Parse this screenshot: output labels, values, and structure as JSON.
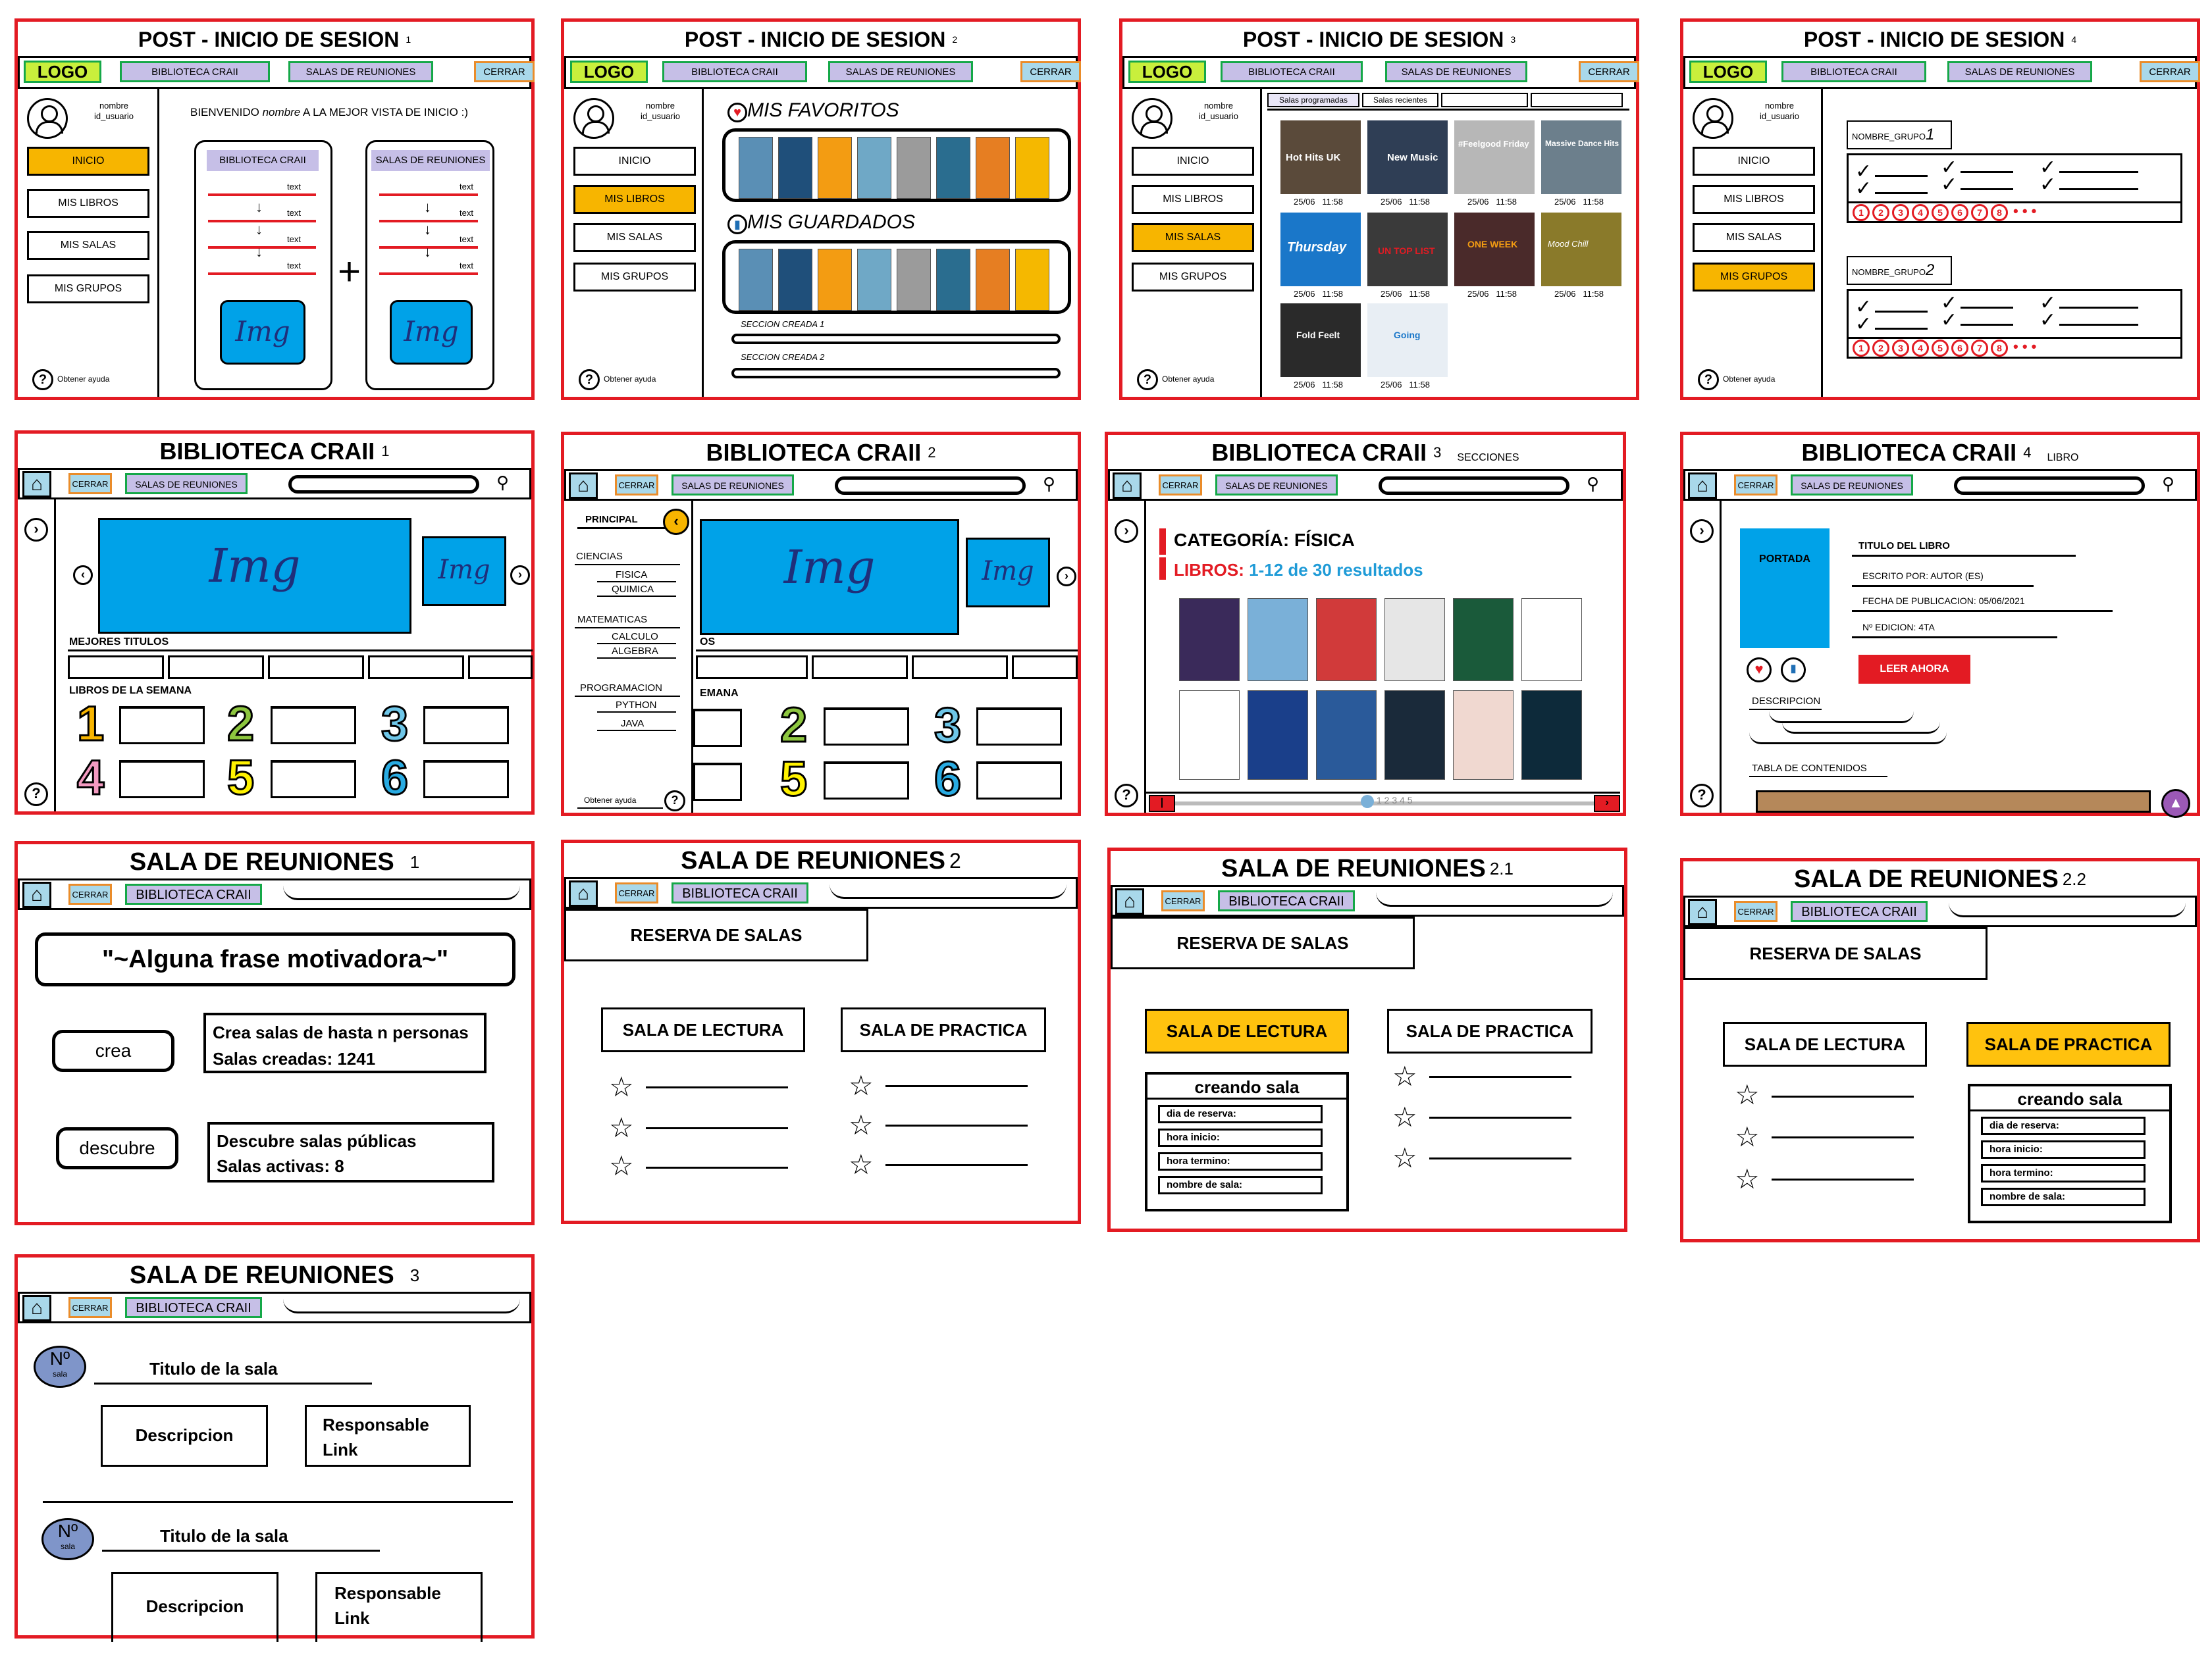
{
  "post1": {
    "title": "POST - INICIO DE SESION",
    "mark": "1",
    "logo": "LOGO",
    "nav": [
      "BIBLIOTECA CRAII",
      "SALAS DE REUNIONES",
      "CERRAR"
    ],
    "user": [
      "nombre",
      "id_usuario"
    ],
    "menu": [
      "INICIO",
      "MIS LIBROS",
      "MIS SALAS",
      "MIS GRUPOS"
    ],
    "help": "Obtener ayuda",
    "welcome_a": "BIENVENIDO ",
    "welcome_name": "nombre",
    "welcome_b": " A LA MEJOR VISTA DE INICIO :)",
    "card1": "BIBLIOTECA CRAII",
    "card2": "SALAS DE REUNIONES",
    "text": "text",
    "img": "Img"
  },
  "post2": {
    "title": "POST - INICIO DE SESION",
    "mark": "2",
    "fav": "MIS FAVORITOS",
    "saved": "MIS GUARDADOS",
    "sec1": "SECCION CREADA 1",
    "sec2": "SECCION CREADA 2"
  },
  "post3": {
    "title": "POST - INICIO DE SESION",
    "mark": "3",
    "tabs": [
      "Salas programadas",
      "Salas recientes"
    ],
    "tiles": [
      "Hot Hits UK",
      "New Music",
      "#Feelgood Friday",
      "Massive Dance Hits",
      "Thursday",
      "UN TOP LIST",
      "ONE WEEK",
      "Mood Chill",
      "Fold Feelt",
      "Going"
    ],
    "date": "25/06",
    "time": "11:58"
  },
  "post4": {
    "title": "POST - INICIO DE SESION",
    "mark": "4",
    "group1": "NOMBRE_GRUPO",
    "g1n": "1",
    "group2": "NOMBRE_GRUPO",
    "g2n": "2",
    "nums": [
      "1",
      "2",
      "3",
      "4",
      "5",
      "6",
      "7",
      "8"
    ],
    "dots": "• • •"
  },
  "bib1": {
    "title": "BIBLIOTECA CRAII",
    "mark": "1",
    "cerrar": "CERRAR",
    "salas": "SALAS DE REUNIONES",
    "best": "MEJORES TITULOS",
    "week": "LIBROS DE LA SEMANA",
    "img": "Img",
    "digits": [
      "1",
      "2",
      "3",
      "4",
      "5",
      "6"
    ]
  },
  "bib2": {
    "title": "BIBLIOTECA CRAII",
    "mark": "2",
    "principal": "PRINCIPAL",
    "cats": [
      "CIENCIAS",
      "FISICA",
      "QUIMICA",
      "MATEMATICAS",
      "CALCULO",
      "ALGEBRA",
      "PROGRAMACION",
      "PYTHON",
      "JAVA"
    ],
    "help": "Obtener ayuda",
    "os": "OS",
    "emana": "EMANA"
  },
  "bib3": {
    "title": "BIBLIOTECA CRAII",
    "mark": "3",
    "sub": "SECCIONES",
    "cat_label": "CATEGORÍA: FÍSICA",
    "books_label": "LIBROS: ",
    "books_val": "1-12 de 30 resultados",
    "pages": "1 2 3 4 5"
  },
  "bib4": {
    "title": "BIBLIOTECA CRAII",
    "mark": "4",
    "sub": "LIBRO",
    "portada": "PORTADA",
    "titulo": "TITULO DEL LIBRO",
    "autor": "ESCRITO POR: AUTOR (ES)",
    "fecha": "FECHA DE PUBLICACION: 05/06/2021",
    "edicion": "Nº EDICION: 4TA",
    "leer": "LEER AHORA",
    "desc": "DESCRIPCION",
    "tabla": "TABLA DE CONTENIDOS"
  },
  "sala1": {
    "title": "SALA DE REUNIONES",
    "mark": "1",
    "bib": "BIBLIOTECA CRAII",
    "frase": "\"~Alguna frase motivadora~\"",
    "crea": "crea",
    "crea_t1": "Crea salas de hasta n personas",
    "crea_t2": "Salas creadas: 1241",
    "descubre": "descubre",
    "desc_t1": "Descubre salas públicas",
    "desc_t2": "Salas activas: 8"
  },
  "sala2": {
    "title": "SALA DE REUNIONES",
    "mark": "2",
    "reserva": "RESERVA DE SALAS",
    "lectura": "SALA DE LECTURA",
    "practica": "SALA DE PRACTICA"
  },
  "sala21": {
    "title": "SALA DE REUNIONES",
    "mark": "2.1",
    "creando": "creando sala",
    "fields": [
      "dia de reserva:",
      "hora inicio:",
      "hora termino:",
      "nombre de sala:"
    ]
  },
  "sala22": {
    "title": "SALA DE REUNIONES",
    "mark": "2.2"
  },
  "sala3": {
    "title": "SALA DE REUNIONES",
    "mark": "3",
    "no": "Nº",
    "sala": "sala",
    "titulo": "Titulo de la sala",
    "desc": "Descripcion",
    "resp": "Responsable",
    "link": "Link"
  },
  "colors": {
    "frame": "#e31b23",
    "yellow": "#f7b500",
    "blue": "#00a2e8",
    "purple": "#c6bfe7",
    "cyan": "#a9d8ea"
  }
}
